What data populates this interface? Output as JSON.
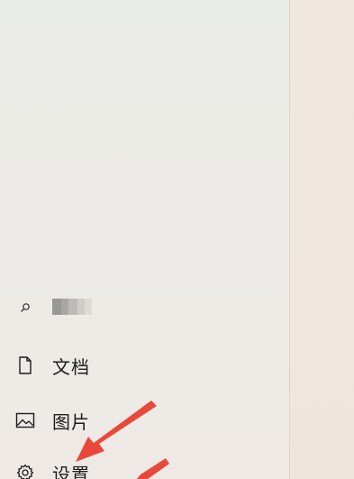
{
  "start_menu": {
    "user": {
      "icon": "magnifier-icon",
      "name_blurred": true
    },
    "items": [
      {
        "label": "文档",
        "icon": "document-icon"
      },
      {
        "label": "图片",
        "icon": "image-icon"
      },
      {
        "label": "设置",
        "icon": "gear-icon"
      }
    ]
  },
  "annotation": {
    "arrow_color": "#e8483a",
    "arrow_icon": "red-arrow-icon"
  },
  "colors": {
    "panel": "#ebebe7",
    "desktop": "#efe6df",
    "text": "#1d1d1d"
  }
}
